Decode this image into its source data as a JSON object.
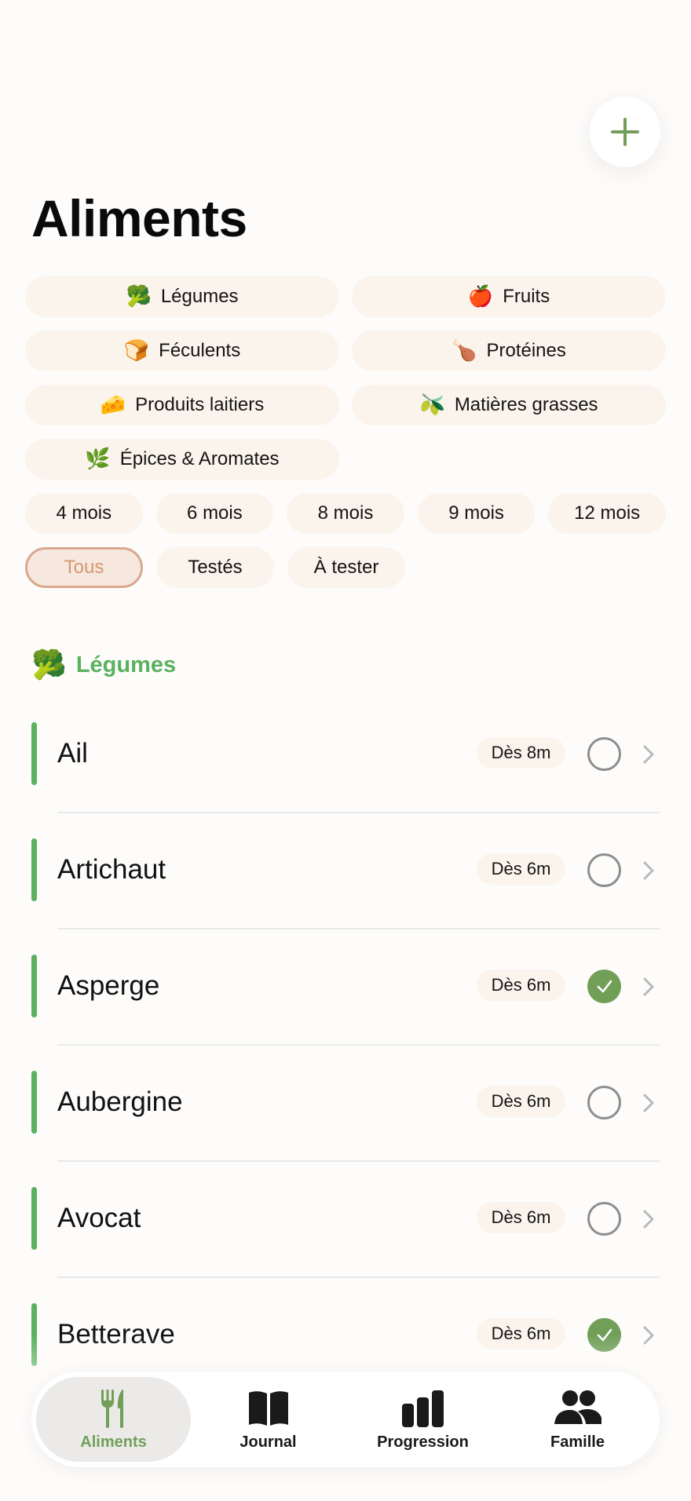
{
  "header": {
    "add_icon": "plus-icon",
    "title": "Aliments"
  },
  "categories": [
    {
      "emoji": "🥦",
      "label": "Légumes"
    },
    {
      "emoji": "🍎",
      "label": "Fruits"
    },
    {
      "emoji": "🍞",
      "label": "Féculents"
    },
    {
      "emoji": "🍗",
      "label": "Protéines"
    },
    {
      "emoji": "🧀",
      "label": "Produits laitiers"
    },
    {
      "emoji": "🫒",
      "label": "Matières grasses"
    },
    {
      "emoji": "🌿",
      "label": "Épices & Aromates"
    }
  ],
  "age_filters": [
    "4 mois",
    "6 mois",
    "8 mois",
    "9 mois",
    "12 mois"
  ],
  "status_filters": [
    "Tous",
    "Testés",
    "À tester"
  ],
  "selected_status": "Tous",
  "section": {
    "emoji": "🥦",
    "label": "Légumes"
  },
  "foods": [
    {
      "name": "Ail",
      "age": "Dès 8m",
      "tested": false
    },
    {
      "name": "Artichaut",
      "age": "Dès 6m",
      "tested": false
    },
    {
      "name": "Asperge",
      "age": "Dès 6m",
      "tested": true
    },
    {
      "name": "Aubergine",
      "age": "Dès 6m",
      "tested": false
    },
    {
      "name": "Avocat",
      "age": "Dès 6m",
      "tested": false
    },
    {
      "name": "Betterave",
      "age": "Dès 6m",
      "tested": true
    }
  ],
  "tabs": [
    {
      "label": "Aliments",
      "icon": "fork-knife-icon",
      "active": true
    },
    {
      "label": "Journal",
      "icon": "book-icon",
      "active": false
    },
    {
      "label": "Progression",
      "icon": "bar-chart-icon",
      "active": false
    },
    {
      "label": "Famille",
      "icon": "people-icon",
      "active": false
    }
  ],
  "colors": {
    "accent_green": "#5bb15e",
    "check_green": "#719f58",
    "chip_bg": "#fbf4ec",
    "selected_border": "#d9a88d"
  }
}
